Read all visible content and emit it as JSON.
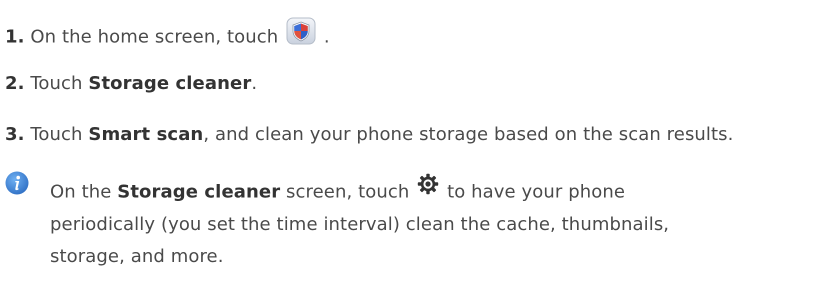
{
  "steps": [
    {
      "number": "1.",
      "text_before": "On the home screen, touch",
      "icon": "phone-manager-shield-icon",
      "text_after": "."
    },
    {
      "number": "2.",
      "text_before": "Touch",
      "bold": "Storage cleaner",
      "text_after": "."
    },
    {
      "number": "3.",
      "text_before": "Touch",
      "bold": "Smart scan",
      "text_after": ", and clean your phone storage based on the scan results."
    }
  ],
  "note": {
    "icon": "info-icon",
    "line1_before": "On the",
    "line1_bold": "Storage cleaner",
    "line1_middle": "screen, touch",
    "settings_icon": "settings-gear-icon",
    "line1_after": "to have your phone",
    "line2": "periodically (you set the time interval) clean the cache, thumbnails,",
    "line3": "storage, and more."
  },
  "colors": {
    "text": "#4a4a4a",
    "info_icon": "#3a7fd1",
    "shield_blue": "#3b6fd8",
    "shield_red": "#d9423b"
  }
}
